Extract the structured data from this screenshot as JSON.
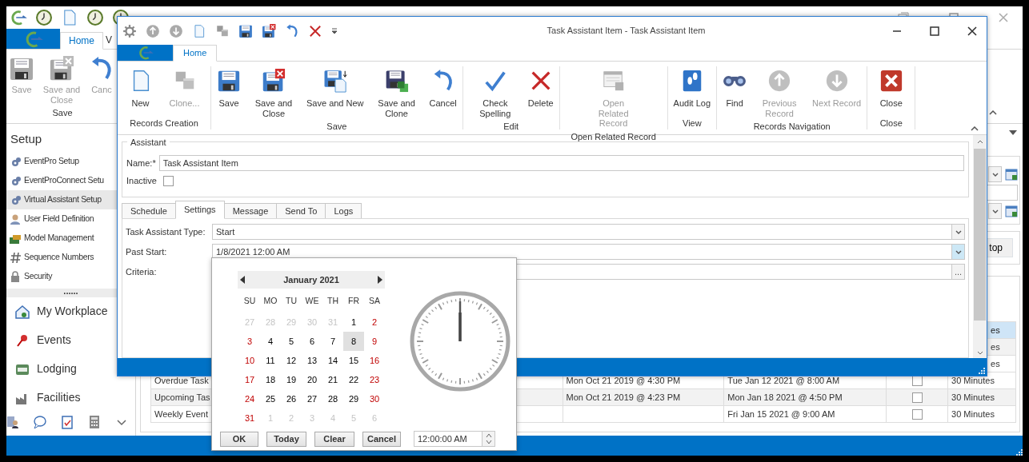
{
  "background_window": {
    "ribbon_tabs": [
      {
        "label": "Home",
        "selected": true
      },
      {
        "label": "V",
        "selected": false
      }
    ],
    "ribbon_buttons": [
      {
        "label": "Save"
      },
      {
        "label": "Save and Close"
      },
      {
        "label": "Canc"
      }
    ],
    "ribbon_group": "Save",
    "sidebar": {
      "title": "Setup",
      "items": [
        {
          "label": "EventPro Setup",
          "selected": false
        },
        {
          "label": "EventProConnect Setu",
          "selected": false
        },
        {
          "label": "Virtual Assistant Setup",
          "selected": true
        },
        {
          "label": "User Field Definition",
          "selected": false
        },
        {
          "label": "Model Management",
          "selected": false
        },
        {
          "label": "Sequence Numbers",
          "selected": false
        },
        {
          "label": "Security",
          "selected": false
        }
      ]
    },
    "splitter": "......",
    "nav": [
      {
        "label": "My Workplace"
      },
      {
        "label": "Events"
      },
      {
        "label": "Lodging"
      },
      {
        "label": "Facilities"
      }
    ],
    "right_strip": {
      "button": "top",
      "interval_fragments": [
        {
          "text": "es",
          "selected": true
        },
        {
          "text": "es",
          "selected": false
        },
        {
          "text": "es",
          "selected": false
        }
      ]
    },
    "grid_rows": [
      {
        "column_1": "Overdue Task",
        "column_3": "Mon Oct 21 2019 @ 4:30 PM",
        "column_4": "Tue Jan 12 2021 @ 8:00 AM",
        "checked": false,
        "column_6": "30 Minutes"
      },
      {
        "column_1": "Upcoming Tas",
        "column_3": "Mon Oct 21 2019 @ 4:23 PM",
        "column_4": "Mon Jan 18 2021 @ 4:50 PM",
        "checked": false,
        "column_6": "30 Minutes"
      },
      {
        "column_1": "Weekly Event",
        "column_4": "Fri Jan 15 2021 @ 9:00 AM",
        "checked": false,
        "column_6": "30 Minutes"
      }
    ]
  },
  "dialog": {
    "title": "Task Assistant Item - Task Assistant Item",
    "ribbon_tabs": [
      {
        "label": "Home",
        "selected": true
      }
    ],
    "ribbon_groups": [
      {
        "label": "Records Creation",
        "buttons": [
          {
            "label": "New",
            "disabled": false
          },
          {
            "label": "Clone...",
            "disabled": true
          }
        ]
      },
      {
        "label": "Save",
        "buttons": [
          {
            "label": "Save",
            "disabled": false
          },
          {
            "label": "Save and Close",
            "disabled": false
          },
          {
            "label": "Save and New",
            "disabled": false
          },
          {
            "label": "Save and Clone",
            "disabled": false
          },
          {
            "label": "Cancel",
            "disabled": false
          }
        ]
      },
      {
        "label": "Edit",
        "buttons": [
          {
            "label": "Check Spelling",
            "disabled": false
          },
          {
            "label": "Delete",
            "disabled": false
          }
        ]
      },
      {
        "label": "Open Related Record",
        "buttons": [
          {
            "label": "Open Related Record",
            "disabled": true
          }
        ]
      },
      {
        "label": "View",
        "buttons": [
          {
            "label": "Audit Log",
            "disabled": false
          }
        ]
      },
      {
        "label": "Records Navigation",
        "buttons": [
          {
            "label": "Find",
            "disabled": false
          },
          {
            "label": "Previous Record",
            "disabled": true
          },
          {
            "label": "Next Record",
            "disabled": true
          }
        ]
      },
      {
        "label": "Close",
        "buttons": [
          {
            "label": "Close",
            "disabled": false
          }
        ]
      }
    ],
    "assistant": {
      "legend": "Assistant",
      "name_label": "Name:*",
      "name_value": "Task Assistant Item",
      "inactive_label": "Inactive",
      "inactive": false
    },
    "tabs": [
      {
        "label": "Schedule",
        "selected": false
      },
      {
        "label": "Settings",
        "selected": true
      },
      {
        "label": "Message",
        "selected": false
      },
      {
        "label": "Send To",
        "selected": false
      },
      {
        "label": "Logs",
        "selected": false
      }
    ],
    "fields": [
      {
        "kind": "combo",
        "label": "Task Assistant Type:",
        "value": "Start",
        "open": false
      },
      {
        "kind": "combo",
        "label": "Past Start:",
        "value": "1/8/2021 12:00 AM",
        "open": true
      },
      {
        "kind": "ellipsis",
        "label": "Criteria:",
        "button": "..."
      }
    ]
  },
  "date_popup": {
    "month": "January 2021",
    "weekdays": [
      "SU",
      "MO",
      "TU",
      "WE",
      "TH",
      "FR",
      "SA"
    ],
    "weeks": [
      [
        {
          "day": "27",
          "other_month": true,
          "selected": false
        },
        {
          "day": "28",
          "other_month": true,
          "selected": false
        },
        {
          "day": "29",
          "other_month": true,
          "selected": false
        },
        {
          "day": "30",
          "other_month": true,
          "selected": false
        },
        {
          "day": "31",
          "other_month": true,
          "selected": false
        },
        {
          "day": "1",
          "other_month": false,
          "selected": false
        },
        {
          "day": "2",
          "other_month": false,
          "selected": false
        }
      ],
      [
        {
          "day": "3",
          "other_month": false,
          "selected": false
        },
        {
          "day": "4",
          "other_month": false,
          "selected": false
        },
        {
          "day": "5",
          "other_month": false,
          "selected": false
        },
        {
          "day": "6",
          "other_month": false,
          "selected": false
        },
        {
          "day": "7",
          "other_month": false,
          "selected": false
        },
        {
          "day": "8",
          "other_month": false,
          "selected": true
        },
        {
          "day": "9",
          "other_month": false,
          "selected": false
        }
      ],
      [
        {
          "day": "10",
          "other_month": false,
          "selected": false
        },
        {
          "day": "11",
          "other_month": false,
          "selected": false
        },
        {
          "day": "12",
          "other_month": false,
          "selected": false
        },
        {
          "day": "13",
          "other_month": false,
          "selected": false
        },
        {
          "day": "14",
          "other_month": false,
          "selected": false
        },
        {
          "day": "15",
          "other_month": false,
          "selected": false
        },
        {
          "day": "16",
          "other_month": false,
          "selected": false
        }
      ],
      [
        {
          "day": "17",
          "other_month": false,
          "selected": false
        },
        {
          "day": "18",
          "other_month": false,
          "selected": false
        },
        {
          "day": "19",
          "other_month": false,
          "selected": false
        },
        {
          "day": "20",
          "other_month": false,
          "selected": false
        },
        {
          "day": "21",
          "other_month": false,
          "selected": false
        },
        {
          "day": "22",
          "other_month": false,
          "selected": false
        },
        {
          "day": "23",
          "other_month": false,
          "selected": false
        }
      ],
      [
        {
          "day": "24",
          "other_month": false,
          "selected": false
        },
        {
          "day": "25",
          "other_month": false,
          "selected": false
        },
        {
          "day": "26",
          "other_month": false,
          "selected": false
        },
        {
          "day": "27",
          "other_month": false,
          "selected": false
        },
        {
          "day": "28",
          "other_month": false,
          "selected": false
        },
        {
          "day": "29",
          "other_month": false,
          "selected": false
        },
        {
          "day": "30",
          "other_month": false,
          "selected": false
        }
      ],
      [
        {
          "day": "31",
          "other_month": false,
          "selected": false
        },
        {
          "day": "1",
          "other_month": true,
          "selected": false
        },
        {
          "day": "2",
          "other_month": true,
          "selected": false
        },
        {
          "day": "3",
          "other_month": true,
          "selected": false
        },
        {
          "day": "4",
          "other_month": true,
          "selected": false
        },
        {
          "day": "5",
          "other_month": true,
          "selected": false
        },
        {
          "day": "6",
          "other_month": true,
          "selected": false
        }
      ]
    ],
    "buttons": [
      "OK",
      "Today",
      "Clear",
      "Cancel"
    ],
    "time": "12:00:00 AM"
  }
}
